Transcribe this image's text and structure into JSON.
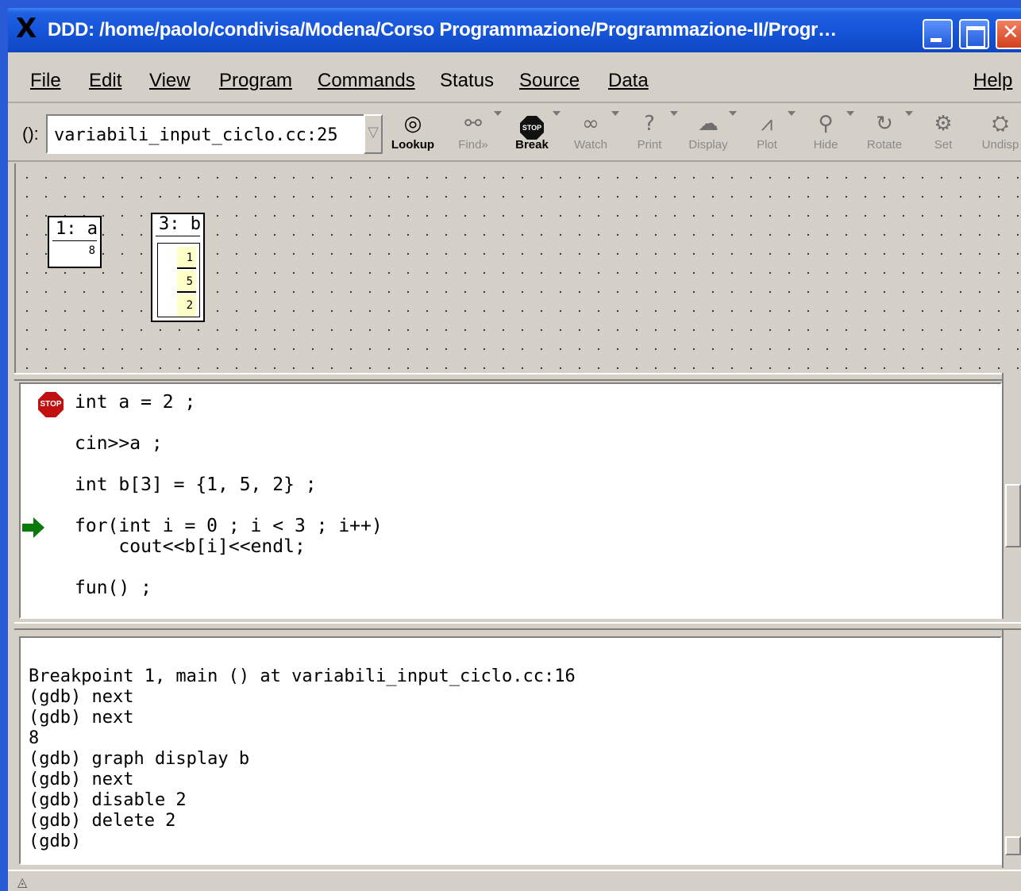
{
  "window": {
    "title": "DDD: /home/paolo/condivisa/Modena/Corso Programmazione/Programmazione-II/Progr…"
  },
  "menubar": {
    "items": [
      {
        "label": "File"
      },
      {
        "label": "Edit"
      },
      {
        "label": "View"
      },
      {
        "label": "Program"
      },
      {
        "label": "Commands"
      },
      {
        "label": "Status"
      },
      {
        "label": "Source"
      },
      {
        "label": "Data"
      },
      {
        "label": "Help"
      }
    ]
  },
  "toolbar": {
    "arg_label": "():",
    "arg_value": "variabili_input_ciclo.cc:25",
    "tools": [
      {
        "label": "Lookup",
        "icon": "lookup-icon",
        "enabled": true
      },
      {
        "label": "Find»",
        "icon": "binoculars-icon",
        "enabled": false
      },
      {
        "label": "Break",
        "icon": "stop-icon",
        "enabled": true
      },
      {
        "label": "Watch",
        "icon": "glasses-icon",
        "enabled": false
      },
      {
        "label": "Print",
        "icon": "question-icon",
        "enabled": false
      },
      {
        "label": "Display",
        "icon": "display-icon",
        "enabled": false
      },
      {
        "label": "Plot",
        "icon": "plot-icon",
        "enabled": false
      },
      {
        "label": "Hide",
        "icon": "magnifier-icon",
        "enabled": false
      },
      {
        "label": "Rotate",
        "icon": "rotate-icon",
        "enabled": false
      },
      {
        "label": "Set",
        "icon": "gears-icon",
        "enabled": false
      },
      {
        "label": "Undisp",
        "icon": "undisplay-icon",
        "enabled": false
      }
    ]
  },
  "displays": {
    "a": {
      "header": "1: a",
      "value": "8"
    },
    "b": {
      "header": "3: b",
      "values": [
        "1",
        "5",
        "2"
      ]
    }
  },
  "source": {
    "lines": [
      "int a = 2 ;",
      "cin>>a ;",
      "int b[3] = {1, 5, 2} ;",
      "for(int i = 0 ; i < 3 ; i++)",
      "    cout<<b[i]<<endl;",
      "fun() ;"
    ],
    "breakpoint_label": "STOP"
  },
  "console": {
    "lines": [
      "Breakpoint 1, main () at variabili_input_ciclo.cc:16",
      "(gdb) next",
      "(gdb) next",
      "8",
      "(gdb) graph display b",
      "(gdb) next",
      "(gdb) disable 2",
      "(gdb) delete 2",
      "(gdb) "
    ]
  },
  "statusbar": {
    "text": ""
  },
  "colors": {
    "titlebar": "#1453d6",
    "window_bg": "#d4d0c8",
    "array_cell": "#ffffc8",
    "breakpoint": "#c01010",
    "exec_arrow": "#0a7a0a"
  }
}
